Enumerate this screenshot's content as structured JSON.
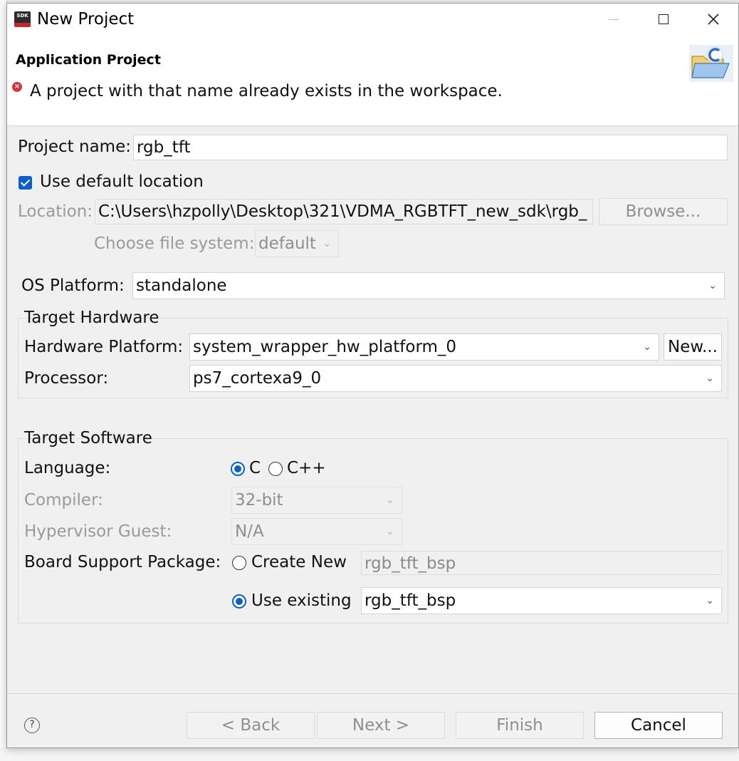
{
  "window": {
    "logo_text": "SDK",
    "title": "New Project"
  },
  "header": {
    "title": "Application Project",
    "error_message": "A project with that name already exists in the workspace."
  },
  "project": {
    "name_label": "Project name:",
    "name_value": "rgb_tft",
    "use_default_label": "Use default location",
    "use_default_checked": true,
    "location_label": "Location:",
    "location_value": "C:\\Users\\hzpolly\\Desktop\\321\\VDMA_RGBTFT_new_sdk\\rgb_",
    "browse_label": "Browse...",
    "filesystem_label": "Choose file system:",
    "filesystem_value": "default"
  },
  "os": {
    "label": "OS Platform:",
    "value": "standalone"
  },
  "target_hardware": {
    "title": "Target Hardware",
    "platform_label": "Hardware Platform:",
    "platform_value": "system_wrapper_hw_platform_0",
    "new_label": "New...",
    "processor_label": "Processor:",
    "processor_value": "ps7_cortexa9_0"
  },
  "target_software": {
    "title": "Target Software",
    "language_label": "Language:",
    "lang_c": "C",
    "lang_cpp": "C++",
    "selected_language": "C",
    "compiler_label": "Compiler:",
    "compiler_value": "32-bit",
    "hypervisor_label": "Hypervisor Guest:",
    "hypervisor_value": "N/A",
    "bsp_label": "Board Support Package:",
    "create_new_label": "Create New",
    "create_new_value": "rgb_tft_bsp",
    "use_existing_label": "Use existing",
    "use_existing_value": "rgb_tft_bsp",
    "bsp_mode": "Use existing"
  },
  "footer": {
    "help": "?",
    "back": "< Back",
    "next": "Next >",
    "finish": "Finish",
    "cancel": "Cancel"
  },
  "icons": {
    "error": "error-icon",
    "wizard": "c-project-folder-icon",
    "help": "help-icon",
    "chevron": "chevron-down-icon"
  },
  "colors": {
    "accent": "#0a60c8",
    "error": "#d6343c",
    "disabled_text": "#9a9a9a"
  }
}
